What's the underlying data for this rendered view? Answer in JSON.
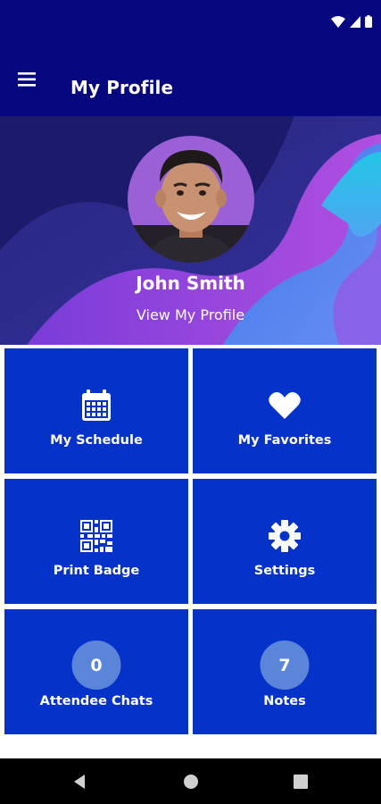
{
  "app_bar": {
    "title": "My Profile"
  },
  "profile": {
    "name": "John Smith",
    "view_link": "View My Profile"
  },
  "tiles": [
    {
      "label": "My Schedule",
      "icon": "calendar-icon"
    },
    {
      "label": "My Favorites",
      "icon": "heart-icon"
    },
    {
      "label": "Print Badge",
      "icon": "qr-code-icon"
    },
    {
      "label": "Settings",
      "icon": "gear-icon"
    },
    {
      "label": "Attendee Chats",
      "count": "0"
    },
    {
      "label": "Notes",
      "count": "7"
    }
  ],
  "colors": {
    "header": "#07077f",
    "tile": "#0532c8",
    "badge": "#5b85d9"
  }
}
